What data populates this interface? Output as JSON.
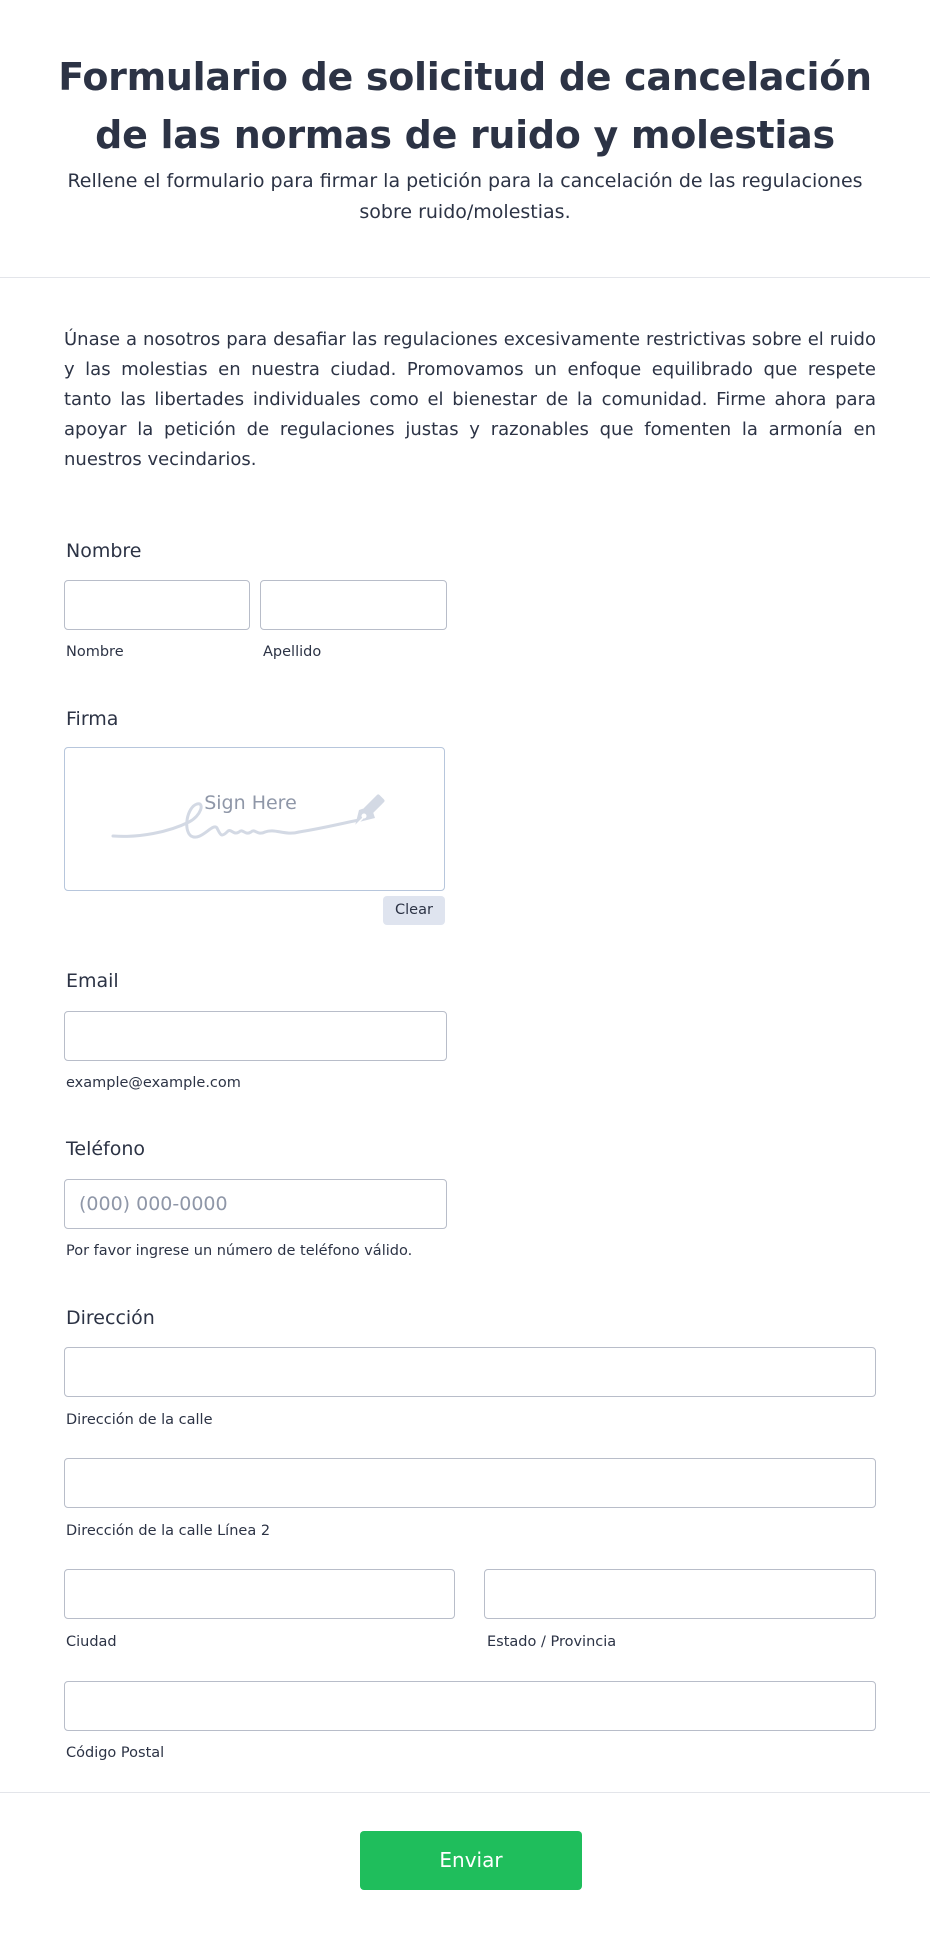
{
  "header": {
    "title": "Formulario de solicitud de cancelación de las normas de ruido y molestias",
    "subtitle": "Rellene el formulario para firmar la petición para la cancelación de las regulaciones sobre ruido/molestias."
  },
  "intro": "Únase a nosotros para desafiar las regulaciones excesivamente restrictivas sobre el ruido y las molestias en nuestra ciudad. Promovamos un enfoque equilibrado que respete tanto las libertades individuales como el bienestar de la comunidad. Firme ahora para apoyar la petición de regulaciones justas y razonables que fomenten la armonía en nuestros vecindarios.",
  "name": {
    "label": "Nombre",
    "first_value": "",
    "last_value": "",
    "first_sublabel": "Nombre",
    "last_sublabel": "Apellido"
  },
  "signature": {
    "label": "Firma",
    "placeholder": "Sign Here",
    "clear_label": "Clear",
    "icon": "pen-nib-icon"
  },
  "email": {
    "label": "Email",
    "value": "",
    "sublabel": "example@example.com"
  },
  "phone": {
    "label": "Teléfono",
    "placeholder": "(000) 000-0000",
    "sublabel": "Por favor ingrese un número de teléfono válido."
  },
  "address": {
    "label": "Dirección",
    "street_sublabel": "Dirección de la calle",
    "street2_sublabel": "Dirección de la calle Línea 2",
    "city_sublabel": "Ciudad",
    "state_sublabel": "Estado / Provincia",
    "postal_sublabel": "Código Postal"
  },
  "submit_label": "Enviar",
  "colors": {
    "text": "#2c3345",
    "placeholder": "#8f97a8",
    "submit": "#1fbe5c",
    "border": "#b8bdc9"
  }
}
